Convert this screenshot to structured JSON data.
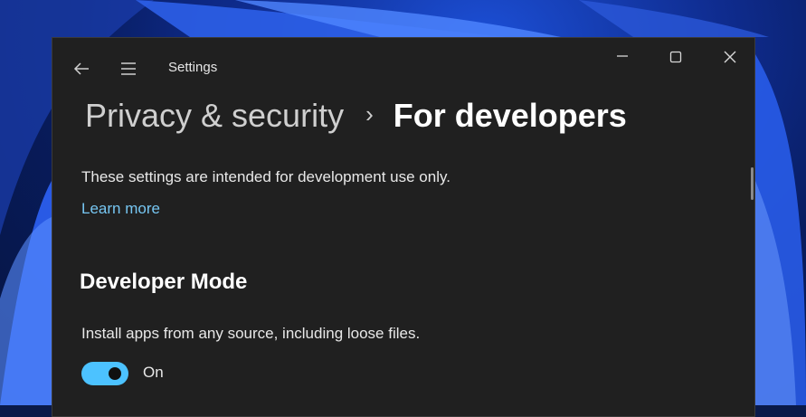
{
  "window": {
    "app_title": "Settings",
    "controls": {
      "minimize": "minimize-icon",
      "maximize": "maximize-icon",
      "close": "close-icon"
    },
    "nav_icons": [
      "back-arrow-icon",
      "hamburger-menu-icon"
    ]
  },
  "breadcrumb": {
    "parent": "Privacy & security",
    "separator": "›",
    "current": "For developers"
  },
  "intro": {
    "text": "These settings are intended for development use only.",
    "link": "Learn more"
  },
  "developer_mode": {
    "heading": "Developer Mode",
    "description": "Install apps from any source, including loose files.",
    "toggle_state": "On",
    "toggle_on": true
  },
  "colors": {
    "window_bg": "#202020",
    "accent": "#4cc2ff",
    "link": "#76c6f2"
  }
}
